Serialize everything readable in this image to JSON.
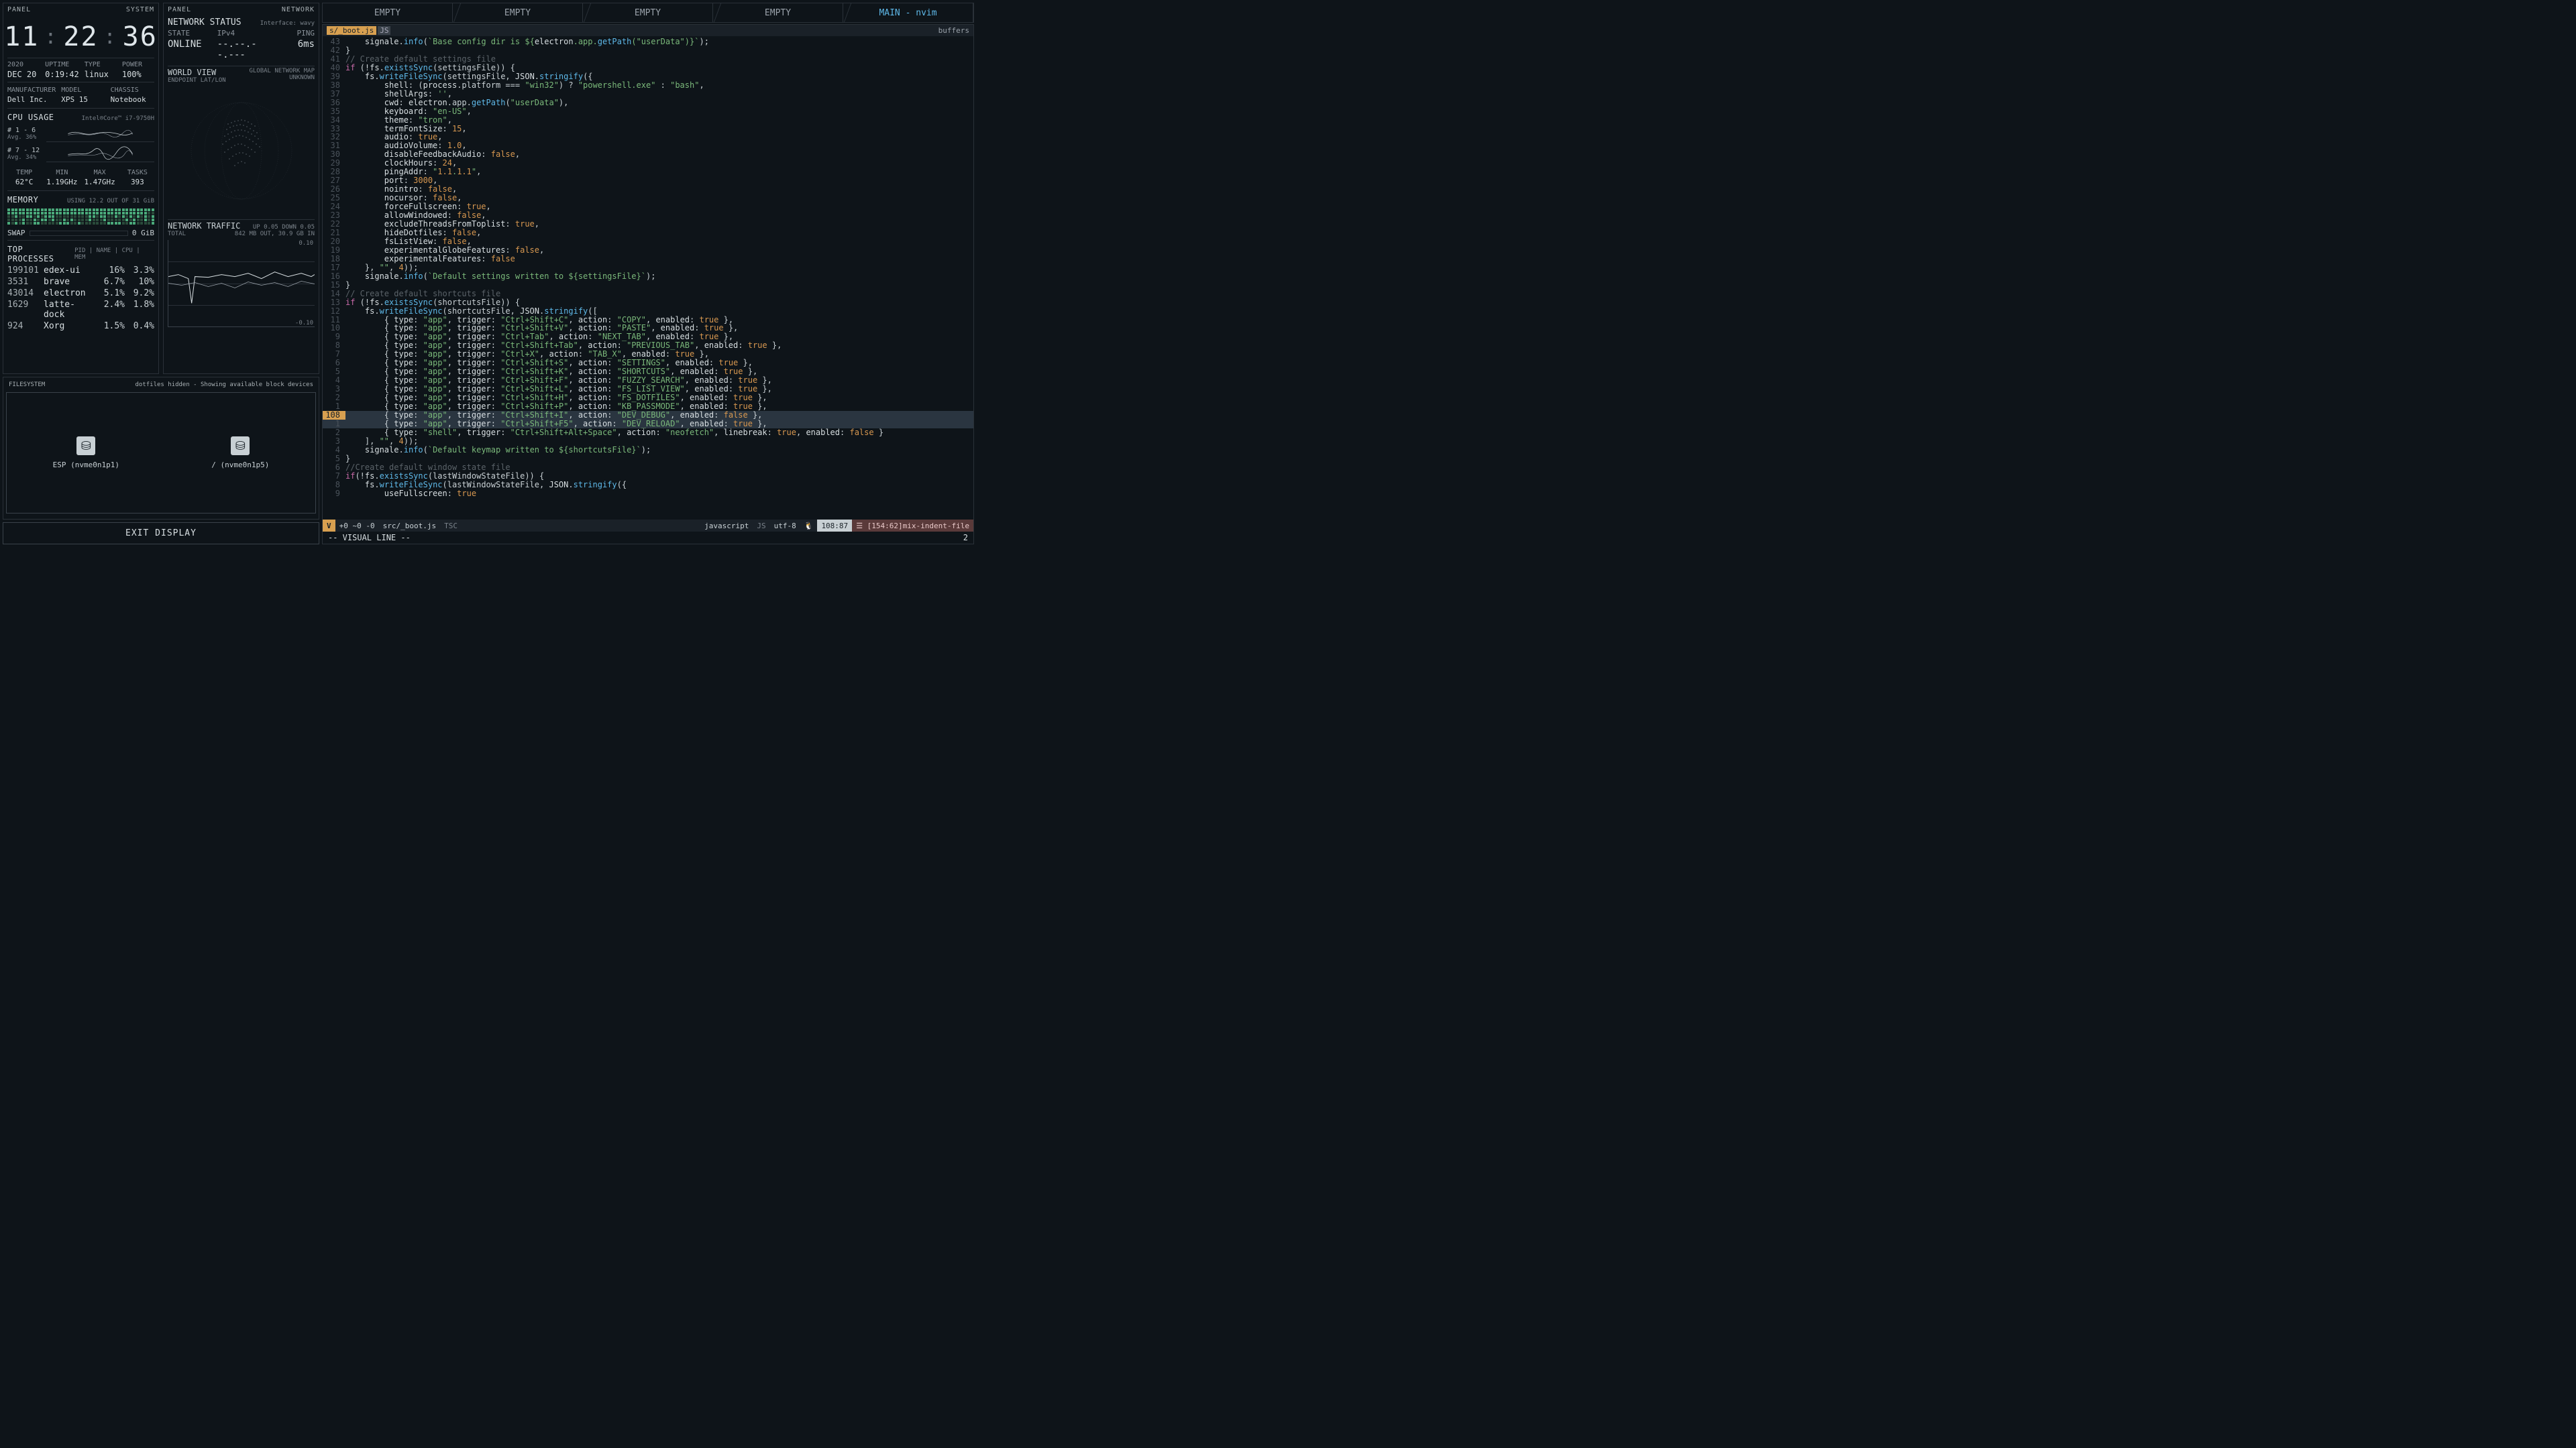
{
  "system_panel": {
    "header_left": "PANEL",
    "header_right": "SYSTEM",
    "clock": {
      "h": "11",
      "m": "22",
      "s": "36"
    },
    "info": {
      "year": "2020",
      "date": "DEC 20",
      "uptime_lbl": "UPTIME",
      "uptime": "0:19:42",
      "type_lbl": "TYPE",
      "type": "linux",
      "power_lbl": "POWER",
      "power": "100%"
    },
    "hw": {
      "mfr_lbl": "MANUFACTURER",
      "mfr": "Dell Inc.",
      "model_lbl": "MODEL",
      "model": "XPS 15",
      "chassis_lbl": "CHASSIS",
      "chassis": "Notebook"
    },
    "cpu": {
      "title": "CPU USAGE",
      "sub": "Intel®Core™ i7-9750H",
      "row1_lbl": "# 1 - 6",
      "row1_avg": "Avg. 36%",
      "row2_lbl": "# 7 - 12",
      "row2_avg": "Avg. 34%",
      "temp_lbl": "TEMP",
      "temp": "62°C",
      "min_lbl": "MIN",
      "min": "1.19GHz",
      "max_lbl": "MAX",
      "max": "1.47GHz",
      "tasks_lbl": "TASKS",
      "tasks": "393"
    },
    "mem": {
      "title": "MEMORY",
      "sub": "USING 12.2 OUT OF 31 GiB"
    },
    "swap": {
      "title": "SWAP",
      "val": "0 GiB"
    },
    "top": {
      "title": "TOP PROCESSES",
      "cols": "PID | NAME | CPU | MEM",
      "rows": [
        {
          "pid": "199101",
          "name": "edex-ui",
          "cpu": "16%",
          "mem": "3.3%"
        },
        {
          "pid": "3531",
          "name": "brave",
          "cpu": "6.7%",
          "mem": "10%"
        },
        {
          "pid": "43014",
          "name": "electron",
          "cpu": "5.1%",
          "mem": "9.2%"
        },
        {
          "pid": "1629",
          "name": "latte-dock",
          "cpu": "2.4%",
          "mem": "1.8%"
        },
        {
          "pid": "924",
          "name": "Xorg",
          "cpu": "1.5%",
          "mem": "0.4%"
        }
      ]
    }
  },
  "network_panel": {
    "header_left": "PANEL",
    "header_right": "NETWORK",
    "status": {
      "title": "NETWORK STATUS",
      "iface": "Interface: wavy",
      "state_lbl": "STATE",
      "state": "ONLINE",
      "ipv4_lbl": "IPv4",
      "ipv4": "--.--.--.---",
      "ping_lbl": "PING",
      "ping": "6ms"
    },
    "world": {
      "title": "WORLD VIEW",
      "sub": "GLOBAL NETWORK MAP",
      "endpoint_lbl": "ENDPOINT LAT/LON",
      "endpoint": "UNKNOWN"
    },
    "traffic": {
      "title": "NETWORK TRAFFIC",
      "sub": "UP 0.05 DOWN 0.05",
      "total_lbl": "TOTAL",
      "total": "842 MB OUT, 30.9 GB IN",
      "ymax": "0.10",
      "ymin": "-0.10"
    }
  },
  "fs": {
    "title": "FILESYSTEM",
    "sub": "dotfiles hidden - Showing available block devices",
    "devices": [
      {
        "label": "ESP (nvme0n1p1)"
      },
      {
        "label": "/ (nvme0n1p5)"
      }
    ]
  },
  "exit": "EXIT DISPLAY",
  "editor": {
    "tabs": [
      "EMPTY",
      "EMPTY",
      "EMPTY",
      "EMPTY",
      "MAIN - nvim"
    ],
    "filename": "s/_boot.js",
    "filetype": "JS",
    "buffers": "buffers",
    "status": {
      "mode": "V",
      "diff": "+0 ~0 -0",
      "path": "src/_boot.js",
      "tsc": "TSC",
      "lang": "javascript",
      "enc": "utf-8",
      "pos": "108:87",
      "lint": "☰ [154:62]mix-indent-file"
    },
    "cmdline": "-- VISUAL LINE --",
    "cmdcount": "2",
    "lines": [
      {
        "n": "43",
        "t": "    signale.info(`Base config dir is ${electron.app.getPath(\"userData\")}`);",
        "hl": false
      },
      {
        "n": "42",
        "t": "}",
        "hl": false
      },
      {
        "n": "41",
        "t": "// Create default settings file",
        "hl": false,
        "cmt": true
      },
      {
        "n": "40",
        "t": "if (!fs.existsSync(settingsFile)) {",
        "hl": false
      },
      {
        "n": "39",
        "t": "    fs.writeFileSync(settingsFile, JSON.stringify({",
        "hl": false
      },
      {
        "n": "38",
        "t": "        shell: (process.platform === \"win32\") ? \"powershell.exe\" : \"bash\",",
        "hl": false
      },
      {
        "n": "37",
        "t": "        shellArgs: '',",
        "hl": false
      },
      {
        "n": "36",
        "t": "        cwd: electron.app.getPath(\"userData\"),",
        "hl": false
      },
      {
        "n": "35",
        "t": "        keyboard: \"en-US\",",
        "hl": false
      },
      {
        "n": "34",
        "t": "        theme: \"tron\",",
        "hl": false
      },
      {
        "n": "33",
        "t": "        termFontSize: 15,",
        "hl": false
      },
      {
        "n": "32",
        "t": "        audio: true,",
        "hl": false
      },
      {
        "n": "31",
        "t": "        audioVolume: 1.0,",
        "hl": false
      },
      {
        "n": "30",
        "t": "        disableFeedbackAudio: false,",
        "hl": false
      },
      {
        "n": "29",
        "t": "        clockHours: 24,",
        "hl": false
      },
      {
        "n": "28",
        "t": "        pingAddr: \"1.1.1.1\",",
        "hl": false
      },
      {
        "n": "27",
        "t": "        port: 3000,",
        "hl": false
      },
      {
        "n": "26",
        "t": "        nointro: false,",
        "hl": false
      },
      {
        "n": "25",
        "t": "        nocursor: false,",
        "hl": false
      },
      {
        "n": "24",
        "t": "        forceFullscreen: true,",
        "hl": false
      },
      {
        "n": "23",
        "t": "        allowWindowed: false,",
        "hl": false
      },
      {
        "n": "22",
        "t": "        excludeThreadsFromToplist: true,",
        "hl": false
      },
      {
        "n": "21",
        "t": "        hideDotfiles: false,",
        "hl": false
      },
      {
        "n": "20",
        "t": "        fsListView: false,",
        "hl": false
      },
      {
        "n": "19",
        "t": "        experimentalGlobeFeatures: false,",
        "hl": false
      },
      {
        "n": "18",
        "t": "        experimentalFeatures: false",
        "hl": false
      },
      {
        "n": "17",
        "t": "    }, \"\", 4));",
        "hl": false
      },
      {
        "n": "16",
        "t": "    signale.info(`Default settings written to ${settingsFile}`);",
        "hl": false
      },
      {
        "n": "15",
        "t": "}",
        "hl": false
      },
      {
        "n": "14",
        "t": "// Create default shortcuts file",
        "hl": false,
        "cmt": true
      },
      {
        "n": "13",
        "t": "if (!fs.existsSync(shortcutsFile)) {",
        "hl": false
      },
      {
        "n": "12",
        "t": "    fs.writeFileSync(shortcutsFile, JSON.stringify([",
        "hl": false
      },
      {
        "n": "11",
        "t": "        { type: \"app\", trigger: \"Ctrl+Shift+C\", action: \"COPY\", enabled: true },",
        "hl": false
      },
      {
        "n": "10",
        "t": "        { type: \"app\", trigger: \"Ctrl+Shift+V\", action: \"PASTE\", enabled: true },",
        "hl": false
      },
      {
        "n": "9",
        "t": "        { type: \"app\", trigger: \"Ctrl+Tab\", action: \"NEXT_TAB\", enabled: true },",
        "hl": false
      },
      {
        "n": "8",
        "t": "        { type: \"app\", trigger: \"Ctrl+Shift+Tab\", action: \"PREVIOUS_TAB\", enabled: true },",
        "hl": false
      },
      {
        "n": "7",
        "t": "        { type: \"app\", trigger: \"Ctrl+X\", action: \"TAB_X\", enabled: true },",
        "hl": false
      },
      {
        "n": "6",
        "t": "        { type: \"app\", trigger: \"Ctrl+Shift+S\", action: \"SETTINGS\", enabled: true },",
        "hl": false
      },
      {
        "n": "5",
        "t": "        { type: \"app\", trigger: \"Ctrl+Shift+K\", action: \"SHORTCUTS\", enabled: true },",
        "hl": false
      },
      {
        "n": "4",
        "t": "        { type: \"app\", trigger: \"Ctrl+Shift+F\", action: \"FUZZY_SEARCH\", enabled: true },",
        "hl": false
      },
      {
        "n": "3",
        "t": "        { type: \"app\", trigger: \"Ctrl+Shift+L\", action: \"FS_LIST_VIEW\", enabled: true },",
        "hl": false
      },
      {
        "n": "2",
        "t": "        { type: \"app\", trigger: \"Ctrl+Shift+H\", action: \"FS_DOTFILES\", enabled: true },",
        "hl": false
      },
      {
        "n": "1",
        "t": "        { type: \"app\", trigger: \"Ctrl+Shift+P\", action: \"KB_PASSMODE\", enabled: true },",
        "hl": false
      },
      {
        "n": "108",
        "t": "        { type: \"app\", trigger: \"Ctrl+Shift+I\", action: \"DEV_DEBUG\", enabled: false },",
        "hl": true,
        "sel": true
      },
      {
        "n": "1",
        "t": "        { type: \"app\", trigger: \"Ctrl+Shift+F5\", action: \"DEV_RELOAD\", enabled: true },",
        "hl": false,
        "sel": true
      },
      {
        "n": "2",
        "t": "        { type: \"shell\", trigger: \"Ctrl+Shift+Alt+Space\", action: \"neofetch\", linebreak: true, enabled: false }",
        "hl": false
      },
      {
        "n": "3",
        "t": "    ], \"\", 4));",
        "hl": false
      },
      {
        "n": "4",
        "t": "    signale.info(`Default keymap written to ${shortcutsFile}`);",
        "hl": false
      },
      {
        "n": "5",
        "t": "}",
        "hl": false
      },
      {
        "n": "6",
        "t": "//Create default window state file",
        "hl": false,
        "cmt": true
      },
      {
        "n": "7",
        "t": "if(!fs.existsSync(lastWindowStateFile)) {",
        "hl": false
      },
      {
        "n": "8",
        "t": "    fs.writeFileSync(lastWindowStateFile, JSON.stringify({",
        "hl": false
      },
      {
        "n": "9",
        "t": "        useFullscreen: true",
        "hl": false
      }
    ]
  }
}
